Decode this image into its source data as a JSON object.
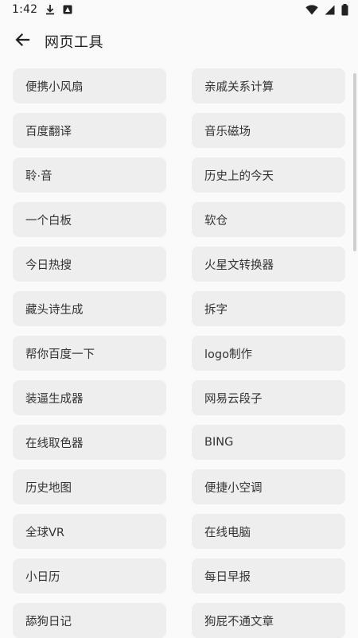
{
  "status": {
    "time": "1:42",
    "icons": [
      "download-icon",
      "app-notification-icon",
      "wifi-icon",
      "signal-icon",
      "battery-icon"
    ]
  },
  "header": {
    "title": "网页工具",
    "back_icon": "arrow-left-icon"
  },
  "tools": [
    {
      "label": "便携小风扇"
    },
    {
      "label": "亲戚关系计算"
    },
    {
      "label": "百度翻译"
    },
    {
      "label": "音乐磁场"
    },
    {
      "label": "聆·音"
    },
    {
      "label": "历史上的今天"
    },
    {
      "label": "一个白板"
    },
    {
      "label": "软仓"
    },
    {
      "label": "今日热搜"
    },
    {
      "label": "火星文转换器"
    },
    {
      "label": "藏头诗生成"
    },
    {
      "label": "拆字"
    },
    {
      "label": "帮你百度一下"
    },
    {
      "label": "logo制作"
    },
    {
      "label": "装逼生成器"
    },
    {
      "label": "网易云段子"
    },
    {
      "label": "在线取色器"
    },
    {
      "label": "BING"
    },
    {
      "label": "历史地图"
    },
    {
      "label": "便捷小空调"
    },
    {
      "label": "全球VR"
    },
    {
      "label": "在线电脑"
    },
    {
      "label": "小日历"
    },
    {
      "label": "每日早报"
    },
    {
      "label": "舔狗日记"
    },
    {
      "label": "狗屁不通文章"
    }
  ],
  "colors": {
    "background": "#fafafa",
    "tile": "#eeeeee",
    "text": "#333333"
  }
}
